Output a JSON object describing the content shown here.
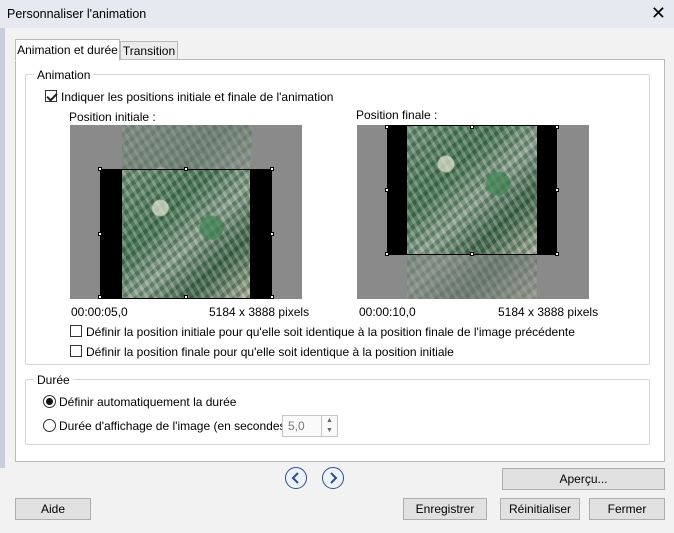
{
  "window": {
    "title": "Personnaliser l'animation"
  },
  "tabs": [
    {
      "label": "Animation et durée",
      "active": true
    },
    {
      "label": "Transition",
      "active": false
    }
  ],
  "animation_group": {
    "legend": "Animation",
    "checkbox_label": "Indiquer les positions initiale et finale de l'animation",
    "checkbox_checked": true,
    "initial": {
      "label": "Position initiale :",
      "time": "00:00:05,0",
      "dimensions": "5184 x 3888 pixels"
    },
    "final": {
      "label": "Position finale :",
      "time": "00:00:10,0",
      "dimensions": "5184 x 3888 pixels"
    },
    "option_same_as_previous": "Définir la position initiale pour qu'elle soit identique à la position finale de l'image précédente",
    "option_same_as_initial": "Définir la position finale pour qu'elle soit identique à la position initiale"
  },
  "duration_group": {
    "legend": "Durée",
    "radio_auto": "Définir automatiquement la durée",
    "radio_manual": "Durée d'affichage de l'image (en secondes)",
    "selected": "auto",
    "value": "5,0"
  },
  "buttons": {
    "preview": "Aperçu...",
    "help": "Aide",
    "save": "Enregistrer",
    "reset": "Réinitialiser",
    "close": "Fermer"
  },
  "icons": {
    "close": "close-icon",
    "prev": "arrow-left-icon",
    "next": "arrow-right-icon",
    "spin_up": "spin-up-icon",
    "spin_down": "spin-down-icon"
  },
  "colors": {
    "nav_accent": "#2b4f8a"
  }
}
